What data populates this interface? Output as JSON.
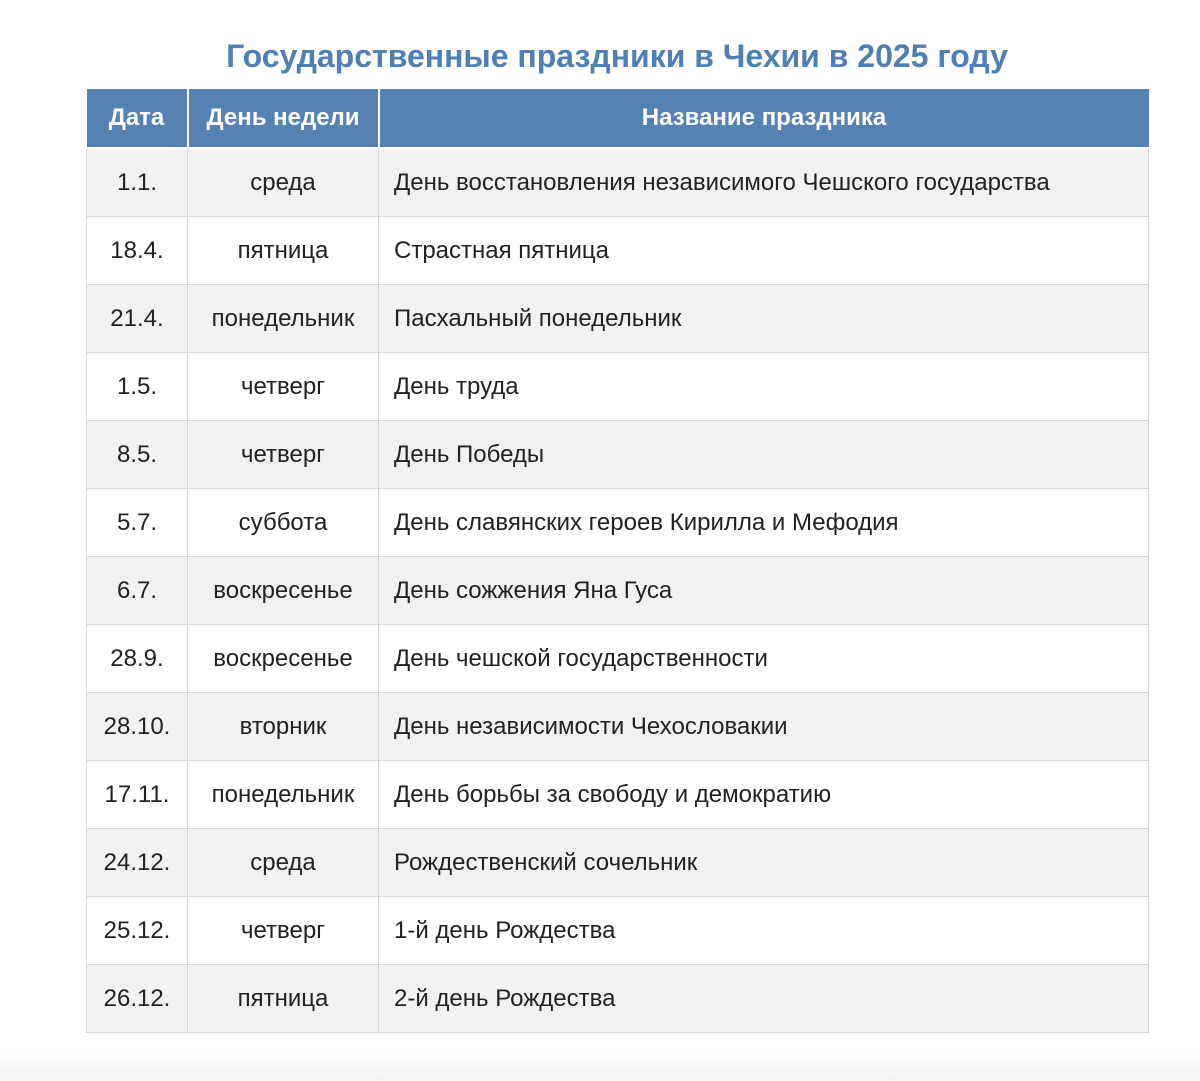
{
  "title": "Государственные праздники в Чехии в 2025 году",
  "table": {
    "headers": [
      "Дата",
      "День недели",
      "Название праздника"
    ],
    "rows": [
      {
        "date": "1.1.",
        "weekday": "среда",
        "name": "День восстановления независимого Чешского государства"
      },
      {
        "date": "18.4.",
        "weekday": "пятница",
        "name": "Страстная пятница"
      },
      {
        "date": "21.4.",
        "weekday": "понедельник",
        "name": "Пасхальный понедельник"
      },
      {
        "date": "1.5.",
        "weekday": "четверг",
        "name": "День труда"
      },
      {
        "date": "8.5.",
        "weekday": "четверг",
        "name": "День Победы"
      },
      {
        "date": "5.7.",
        "weekday": "суббота",
        "name": "День славянских героев Кирилла и Мефодия"
      },
      {
        "date": "6.7.",
        "weekday": "воскресенье",
        "name": "День сожжения Яна Гуса"
      },
      {
        "date": "28.9.",
        "weekday": "воскресенье",
        "name": "День чешской государственности"
      },
      {
        "date": "28.10.",
        "weekday": "вторник",
        "name": "День независимости Чехословакии"
      },
      {
        "date": "17.11.",
        "weekday": "понедельник",
        "name": "День борьбы за свободу и демократию"
      },
      {
        "date": "24.12.",
        "weekday": "среда",
        "name": "Рождественский сочельник"
      },
      {
        "date": "25.12.",
        "weekday": "четверг",
        "name": "1-й день Рождества"
      },
      {
        "date": "26.12.",
        "weekday": "пятница",
        "name": "2-й день Рождества"
      }
    ]
  },
  "colors": {
    "title": "#4f7fb3",
    "header_bg": "#5681b3",
    "header_text": "#ffffff",
    "row_odd": "#f2f2f2",
    "row_even": "#ffffff",
    "border": "#d7d7d7"
  }
}
